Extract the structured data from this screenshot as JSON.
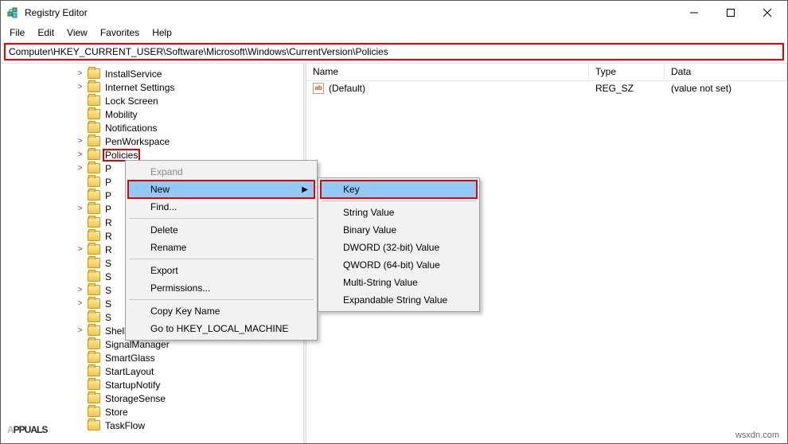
{
  "title": "Registry Editor",
  "menubar": [
    "File",
    "Edit",
    "View",
    "Favorites",
    "Help"
  ],
  "window_controls": {
    "min": "minimize",
    "max": "maximize",
    "close": "close"
  },
  "address": "Computer\\HKEY_CURRENT_USER\\Software\\Microsoft\\Windows\\CurrentVersion\\Policies",
  "tree": [
    {
      "label": "InstallService",
      "exp": ">"
    },
    {
      "label": "Internet Settings",
      "exp": ">"
    },
    {
      "label": "Lock Screen",
      "exp": ""
    },
    {
      "label": "Mobility",
      "exp": ""
    },
    {
      "label": "Notifications",
      "exp": ""
    },
    {
      "label": "PenWorkspace",
      "exp": ">"
    },
    {
      "label": "Policies",
      "exp": ">",
      "selected": true
    },
    {
      "label": "P",
      "exp": ">"
    },
    {
      "label": "P",
      "exp": ""
    },
    {
      "label": "P",
      "exp": ""
    },
    {
      "label": "P",
      "exp": ">"
    },
    {
      "label": "R",
      "exp": ""
    },
    {
      "label": "R",
      "exp": ""
    },
    {
      "label": "R",
      "exp": ">"
    },
    {
      "label": "S",
      "exp": ""
    },
    {
      "label": "S",
      "exp": ""
    },
    {
      "label": "S",
      "exp": ">"
    },
    {
      "label": "S",
      "exp": ">"
    },
    {
      "label": "S",
      "exp": ""
    },
    {
      "label": "Shell Extensions",
      "exp": ">"
    },
    {
      "label": "SignalManager",
      "exp": ""
    },
    {
      "label": "SmartGlass",
      "exp": ""
    },
    {
      "label": "StartLayout",
      "exp": ""
    },
    {
      "label": "StartupNotify",
      "exp": ""
    },
    {
      "label": "StorageSense",
      "exp": ""
    },
    {
      "label": "Store",
      "exp": ""
    },
    {
      "label": "TaskFlow",
      "exp": ""
    }
  ],
  "list": {
    "columns": {
      "name": "Name",
      "type": "Type",
      "data": "Data"
    },
    "rows": [
      {
        "name": "(Default)",
        "type": "REG_SZ",
        "data": "(value not set)"
      }
    ]
  },
  "ctxmenu": {
    "items": [
      {
        "label": "Expand",
        "disabled": true
      },
      {
        "label": "New",
        "sub": true,
        "hl": true,
        "boxed": true
      },
      {
        "label": "Find..."
      },
      {
        "sep": true
      },
      {
        "label": "Delete"
      },
      {
        "label": "Rename"
      },
      {
        "sep": true
      },
      {
        "label": "Export"
      },
      {
        "label": "Permissions..."
      },
      {
        "sep": true
      },
      {
        "label": "Copy Key Name"
      },
      {
        "label": "Go to HKEY_LOCAL_MACHINE"
      }
    ]
  },
  "submenu": {
    "items": [
      {
        "label": "Key",
        "hl": true,
        "boxed": true
      },
      {
        "sep": true
      },
      {
        "label": "String Value"
      },
      {
        "label": "Binary Value"
      },
      {
        "label": "DWORD (32-bit) Value"
      },
      {
        "label": "QWORD (64-bit) Value"
      },
      {
        "label": "Multi-String Value"
      },
      {
        "label": "Expandable String Value"
      }
    ]
  },
  "brand_left": "PPUALS",
  "brand_right": "wsxdn.com"
}
